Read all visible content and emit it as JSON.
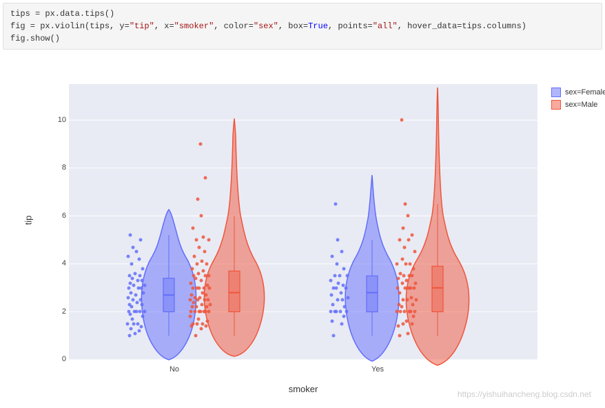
{
  "code": {
    "line1_pre": "tips = px.data.tips()",
    "line2": "fig = px.violin(tips, y=\"tip\", x=\"smoker\", color=\"sex\", box=True, points=\"all\", hover_data=tips.columns)",
    "line3": "fig.show()"
  },
  "chart_data": {
    "type": "violin",
    "xlabel": "smoker",
    "ylabel": "tip",
    "ylim": [
      0,
      11.5
    ],
    "categories": [
      "No",
      "Yes"
    ],
    "legend": [
      {
        "name": "sex=Female",
        "color": "#636efa"
      },
      {
        "name": "sex=Male",
        "color": "#ef553b"
      }
    ],
    "y_ticks": [
      0,
      2,
      4,
      6,
      8,
      10
    ],
    "series": [
      {
        "name": "sex=Female",
        "smoker": "No",
        "box": {
          "q1": 2.0,
          "median": 2.7,
          "q3": 3.4,
          "whisker_lo": 1.0,
          "whisker_hi": 5.2
        },
        "points": [
          1.0,
          1.1,
          1.2,
          1.3,
          1.4,
          1.5,
          1.5,
          1.5,
          1.7,
          1.8,
          1.9,
          2.0,
          2.0,
          2.0,
          2.0,
          2.0,
          2.2,
          2.3,
          2.3,
          2.4,
          2.5,
          2.5,
          2.6,
          2.7,
          2.8,
          2.8,
          3.0,
          3.0,
          3.0,
          3.1,
          3.1,
          3.2,
          3.3,
          3.3,
          3.4,
          3.5,
          3.5,
          3.6,
          3.8,
          4.0,
          4.2,
          4.3,
          4.5,
          4.7,
          5.0,
          5.2
        ]
      },
      {
        "name": "sex=Male",
        "smoker": "No",
        "box": {
          "q1": 2.0,
          "median": 2.8,
          "q3": 3.7,
          "whisker_lo": 1.0,
          "whisker_hi": 6.0
        },
        "outliers": [
          6.7,
          7.6,
          9.0
        ],
        "points": [
          1.0,
          1.3,
          1.4,
          1.4,
          1.5,
          1.5,
          1.5,
          1.6,
          1.7,
          1.8,
          2.0,
          2.0,
          2.0,
          2.0,
          2.0,
          2.0,
          2.0,
          2.2,
          2.2,
          2.2,
          2.3,
          2.3,
          2.4,
          2.5,
          2.5,
          2.5,
          2.5,
          2.6,
          2.6,
          2.7,
          2.7,
          2.8,
          3.0,
          3.0,
          3.0,
          3.0,
          3.0,
          3.1,
          3.2,
          3.3,
          3.4,
          3.5,
          3.5,
          3.5,
          3.6,
          3.7,
          3.8,
          4.0,
          4.0,
          4.1,
          4.3,
          4.5,
          4.7,
          5.0,
          5.0,
          5.1,
          5.5,
          6.0,
          6.7,
          7.6,
          9.0
        ]
      },
      {
        "name": "sex=Female",
        "smoker": "Yes",
        "box": {
          "q1": 2.0,
          "median": 2.8,
          "q3": 3.5,
          "whisker_lo": 1.0,
          "whisker_hi": 5.0
        },
        "outliers": [
          6.5
        ],
        "points": [
          1.0,
          1.5,
          1.6,
          1.8,
          2.0,
          2.0,
          2.0,
          2.0,
          2.0,
          2.2,
          2.3,
          2.5,
          2.5,
          2.6,
          2.7,
          2.8,
          3.0,
          3.0,
          3.0,
          3.1,
          3.2,
          3.3,
          3.5,
          3.5,
          3.5,
          3.8,
          4.0,
          4.3,
          4.5,
          5.0,
          6.5
        ]
      },
      {
        "name": "sex=Male",
        "smoker": "Yes",
        "box": {
          "q1": 2.0,
          "median": 3.0,
          "q3": 3.9,
          "whisker_lo": 1.0,
          "whisker_hi": 6.5
        },
        "outliers": [
          10.0
        ],
        "points": [
          1.0,
          1.1,
          1.4,
          1.5,
          1.5,
          1.6,
          1.8,
          2.0,
          2.0,
          2.0,
          2.0,
          2.0,
          2.0,
          2.2,
          2.3,
          2.3,
          2.5,
          2.5,
          2.5,
          2.6,
          2.8,
          3.0,
          3.0,
          3.0,
          3.0,
          3.0,
          3.2,
          3.2,
          3.3,
          3.4,
          3.5,
          3.5,
          3.5,
          3.6,
          3.8,
          4.0,
          4.0,
          4.0,
          4.2,
          4.5,
          4.7,
          5.0,
          5.0,
          5.2,
          5.5,
          6.0,
          6.5,
          10.0
        ]
      }
    ]
  },
  "watermark": "https://yishuihancheng.blog.csdn.net"
}
